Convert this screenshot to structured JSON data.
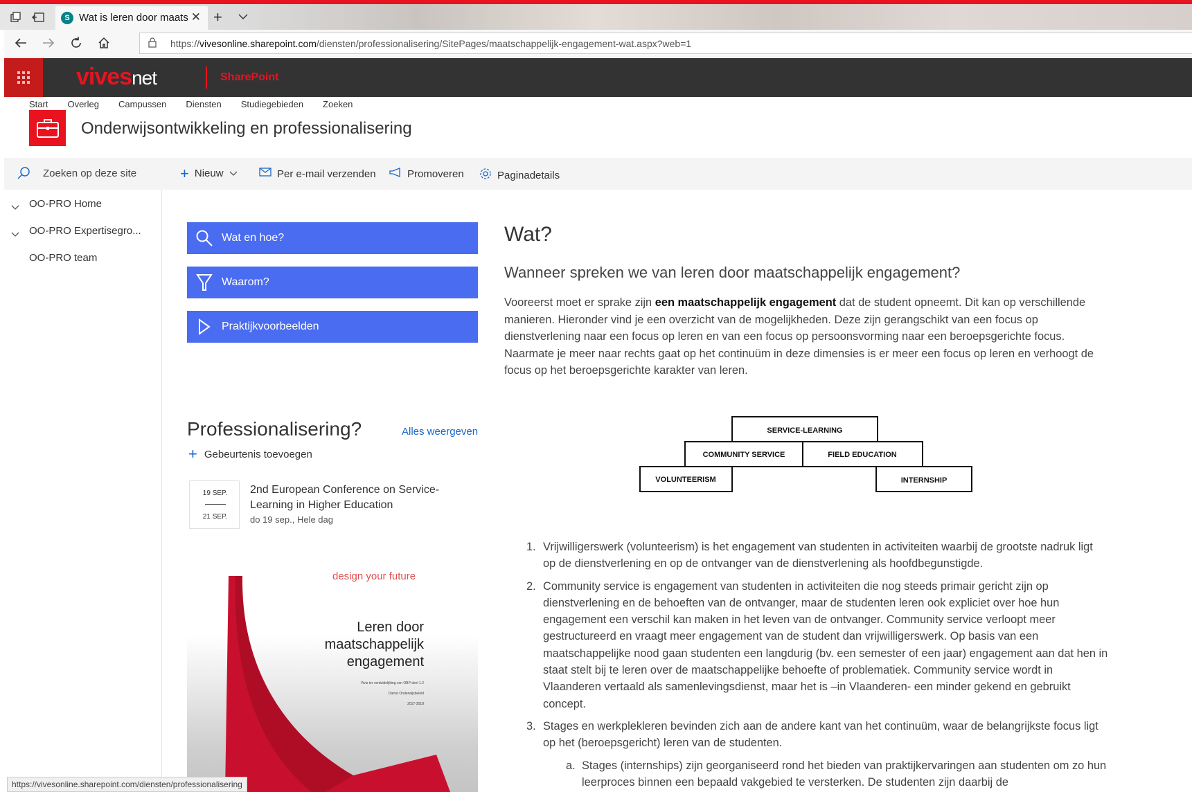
{
  "browser": {
    "tab_title": "Wat is leren door maats",
    "url_prefix": "https://",
    "url_host": "vivesonline.sharepoint.com",
    "url_path": "/diensten/professionalisering/SitePages/maatschappelijk-engagement-wat.aspx?web=1",
    "status_url": "https://vivesonline.sharepoint.com/diensten/professionalisering"
  },
  "suite": {
    "brand_main": "vives",
    "brand_suffix": "net",
    "app_label": "SharePoint"
  },
  "site": {
    "top_nav": [
      "Start",
      "Overleg",
      "Campussen",
      "Diensten",
      "Studiegebieden",
      "Zoeken"
    ],
    "title": "Onderwijsontwikkeling en professionalisering"
  },
  "commandbar": {
    "search_placeholder": "Zoeken op deze site",
    "new_label": "Nieuw",
    "email_label": "Per e-mail verzenden",
    "promote_label": "Promoveren",
    "details_label": "Paginadetails"
  },
  "leftnav": {
    "items": [
      "OO-PRO Home",
      "OO-PRO Expertisegro...",
      "OO-PRO team"
    ]
  },
  "quicklinks": [
    "Wat en hoe?",
    "Waarom?",
    "Praktijkvoorbeelden"
  ],
  "events": {
    "title": "Professionalisering?",
    "view_all": "Alles weergeven",
    "add_label": "Gebeurtenis toevoegen",
    "item": {
      "date_start": "19 SEP.",
      "date_end": "21 SEP.",
      "name": "2nd European Conference on Service-Learning in Higher Education",
      "meta": "do 19 sep., Hele dag"
    }
  },
  "brochure": {
    "tagline": "design your future",
    "title_1": "Leren door",
    "title_2": "maatschappelijk",
    "title_3": "engagement",
    "small_1": "Vivis ter verduidelijking van OBP deel 1.2",
    "small_2": "Dienst Onderwijsbeleid",
    "small_3": "2017-2018"
  },
  "article": {
    "heading": "Wat?",
    "subheading": "Wanneer spreken we van leren door maatschappelijk engagement?",
    "intro_before": "Vooreerst moet er sprake zijn ",
    "intro_bold": "een maatschappelijk engagement",
    "intro_after": " dat de student opneemt. Dit kan op verschillende manieren. Hieronder vind je een overzicht van de mogelijkheden. Deze zijn gerangschikt van een focus op dienstverlening naar een focus op leren en van een focus op persoonsvorming naar een beroepsgerichte focus. Naarmate je meer naar rechts gaat op het continuüm in deze dimensies is er meer een focus op leren en verhoogt de focus op het beroepsgerichte karakter van leren.",
    "diagram": {
      "top": "SERVICE-LEARNING",
      "mid_left": "COMMUNITY SERVICE",
      "mid_right": "FIELD EDUCATION",
      "bottom_left": "VOLUNTEERISM",
      "bottom_right": "INTERNSHIP"
    },
    "list": [
      {
        "num": "1.",
        "text": "Vrijwilligerswerk (volunteerism) is het engagement van studenten in activiteiten waarbij de grootste nadruk ligt op de dienstverlening en op de ontvanger van de dienstverlening als hoofdbegunstigde."
      },
      {
        "num": "2.",
        "text": "Community service is engagement van studenten in activiteiten die nog steeds primair gericht zijn op dienstverlening en de behoeften van de ontvanger, maar de studenten leren ook expliciet over hoe hun engagement een verschil kan maken in het leven van de ontvanger. Community service verloopt meer gestructureerd en vraagt meer engagement van de student dan vrijwilligerswerk. Op basis van een maatschappelijke nood gaan studenten een langdurig (bv. een semester of een jaar) engagement aan dat hen in staat stelt bij te leren over de maatschappelijke behoefte of problematiek. Community service wordt in Vlaanderen vertaald als samenlevingsdienst, maar het is –in Vlaanderen- een minder gekend en gebruikt concept."
      },
      {
        "num": "3.",
        "text": "Stages en werkplekleren bevinden zich aan de andere kant van het continuüm, waar de belangrijkste focus ligt op het (beroepsgericht) leren van de studenten."
      }
    ],
    "sublist": [
      {
        "num": "a.",
        "text": "Stages (internships) zijn georganiseerd rond het bieden van praktijkervaringen aan studenten om zo hun leerproces binnen een bepaald vakgebied te versterken. De studenten zijn daarbij de"
      }
    ]
  }
}
